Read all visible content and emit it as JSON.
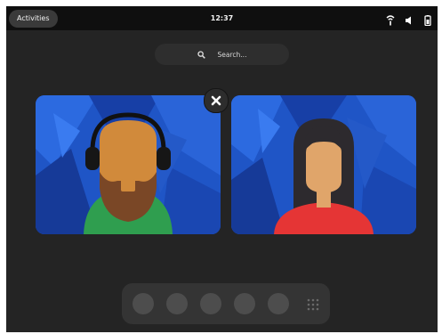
{
  "topbar": {
    "activities_label": "Activities",
    "clock": "12:37",
    "tray_icons": [
      "network-icon",
      "volume-icon",
      "battery-icon"
    ]
  },
  "search": {
    "placeholder": "Search..."
  },
  "windows": [
    {
      "name": "window-thumbnail-man-with-headphones",
      "has_close": true
    },
    {
      "name": "window-thumbnail-woman-long-hair",
      "has_close": false
    }
  ],
  "dash": {
    "apps": [
      "app-1",
      "app-2",
      "app-3",
      "app-4",
      "app-5"
    ],
    "show_apps_icon": "grid-icon"
  },
  "colors": {
    "screen_bg": "#242424",
    "topbar_bg": "#0f0f0f",
    "wallpaper_blue": "#1d4bb4",
    "accent_green": "#2f9e4f",
    "accent_red": "#e53535"
  }
}
